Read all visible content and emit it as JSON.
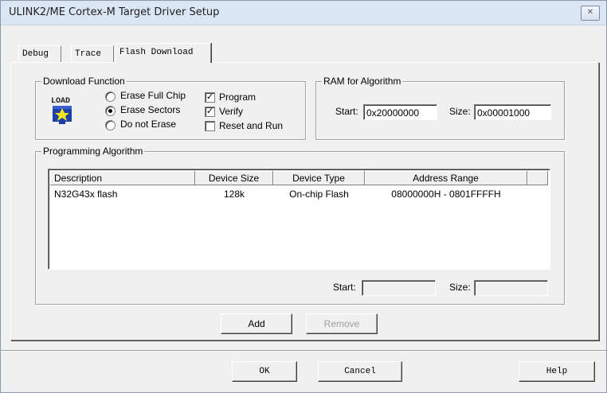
{
  "window": {
    "title": "ULINK2/ME Cortex-M Target Driver Setup",
    "close_glyph": "✕"
  },
  "tabs": [
    {
      "label": "Debug",
      "active": false
    },
    {
      "label": "Trace",
      "active": false
    },
    {
      "label": "Flash Download",
      "active": true
    }
  ],
  "download_function": {
    "title": "Download Function",
    "icon": "load-icon",
    "icon_text": "LOAD",
    "options": [
      {
        "label": "Erase Full Chip",
        "selected": false
      },
      {
        "label": "Erase Sectors",
        "selected": true
      },
      {
        "label": "Do not Erase",
        "selected": false
      }
    ],
    "checks": [
      {
        "label": "Program",
        "checked": true
      },
      {
        "label": "Verify",
        "checked": true
      },
      {
        "label": "Reset and Run",
        "checked": false
      }
    ],
    "check_glyph": "✓"
  },
  "ram": {
    "title": "RAM for Algorithm",
    "start_label": "Start:",
    "start_value": "0x20000000",
    "size_label": "Size:",
    "size_value": "0x00001000"
  },
  "programming": {
    "title": "Programming Algorithm",
    "columns": [
      "Description",
      "Device Size",
      "Device Type",
      "Address Range"
    ],
    "rows": [
      [
        "N32G43x flash",
        "128k",
        "On-chip Flash",
        "08000000H - 0801FFFFH"
      ]
    ],
    "start_label": "Start:",
    "start_value": "",
    "size_label": "Size:",
    "size_value": ""
  },
  "buttons": {
    "add": "Add",
    "remove": "Remove",
    "ok": "OK",
    "cancel": "Cancel",
    "help": "Help"
  }
}
